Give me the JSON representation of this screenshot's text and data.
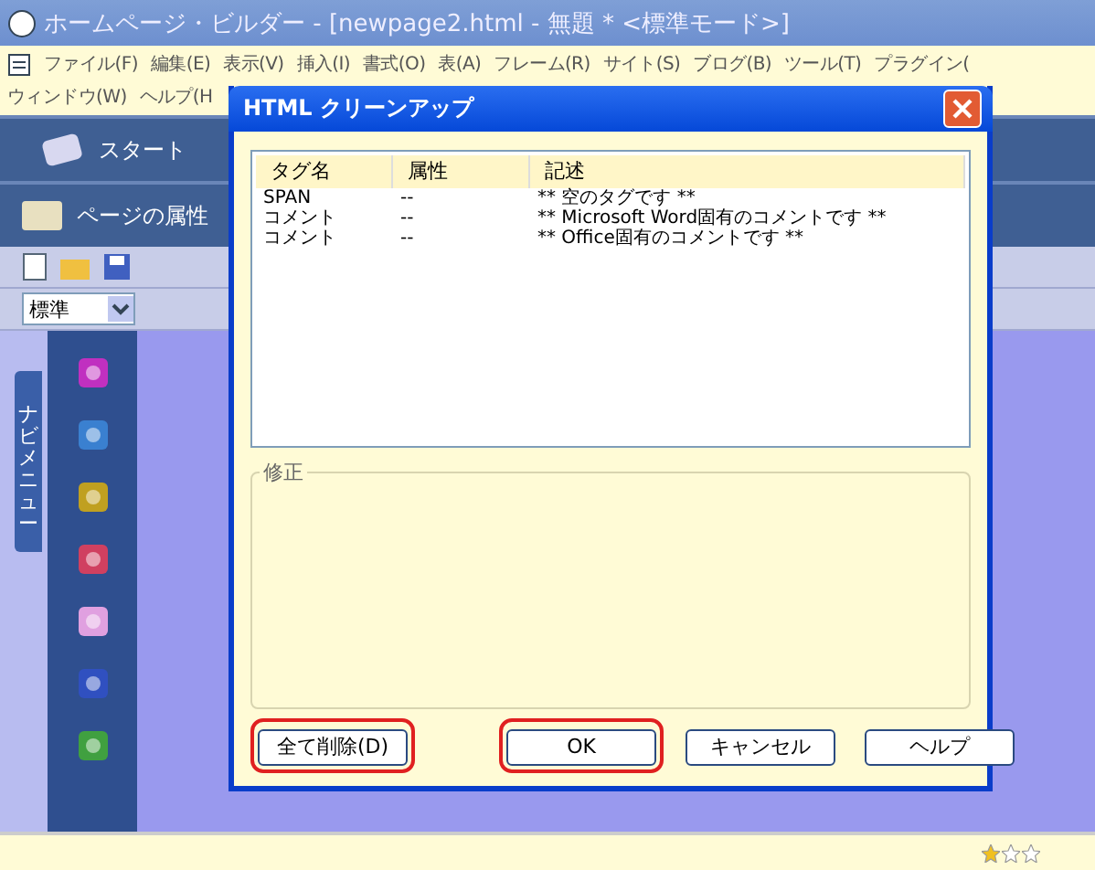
{
  "window": {
    "title": "ホームページ・ビルダー - [newpage2.html - 無題 * <標準モード>]"
  },
  "menu_rows": [
    [
      "ファイル(F)",
      "編集(E)",
      "表示(V)",
      "挿入(I)",
      "書式(O)",
      "表(A)",
      "フレーム(R)",
      "サイト(S)",
      "ブログ(B)",
      "ツール(T)",
      "プラグイン("
    ],
    [
      "ウィンドウ(W)",
      "ヘルプ(H"
    ]
  ],
  "bands": [
    {
      "label": "スタート"
    },
    {
      "label": "ページの属性"
    }
  ],
  "style_select": {
    "value": "標準"
  },
  "nav": {
    "label": "ナビメニュー"
  },
  "dialog": {
    "title": "HTML クリーンアップ",
    "columns": [
      "タグ名",
      "属性",
      "記述"
    ],
    "rows": [
      [
        "SPAN",
        "--",
        "** 空のタグです **"
      ],
      [
        "コメント",
        "--",
        "** Microsoft Word固有のコメントです **"
      ],
      [
        "コメント",
        "--",
        "** Office固有のコメントです **"
      ]
    ],
    "group_label": "修正",
    "buttons": [
      {
        "label": "全て削除(D)",
        "highlighted": true,
        "kind": "left"
      },
      {
        "label": "OK",
        "highlighted": true,
        "kind": "right"
      },
      {
        "label": "キャンセル",
        "highlighted": false,
        "kind": "right"
      },
      {
        "label": "ヘルプ",
        "highlighted": false,
        "kind": "right"
      }
    ]
  },
  "status_bar": {
    "stars": 1
  }
}
